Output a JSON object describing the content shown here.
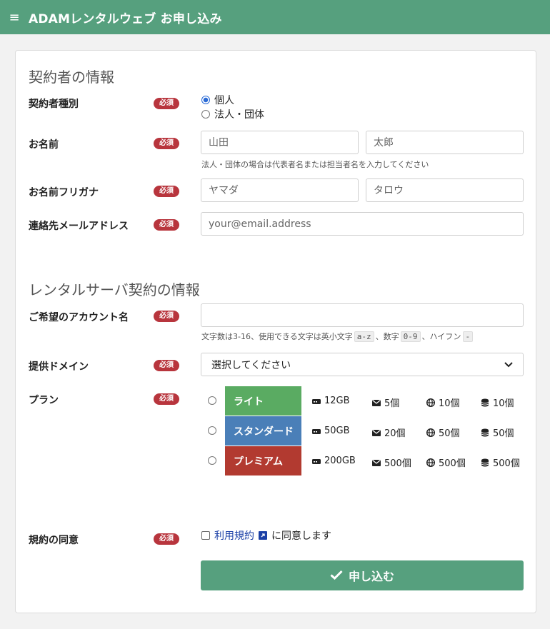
{
  "header": {
    "title": "ADAMレンタルウェブ お申し込み"
  },
  "required_label": "必須",
  "section1": {
    "title": "契約者の情報",
    "type": {
      "label": "契約者種別",
      "options": [
        "個人",
        "法人・団体"
      ],
      "selected": 0
    },
    "name": {
      "label": "お名前",
      "last_placeholder": "山田",
      "first_placeholder": "太郎",
      "help": "法人・団体の場合は代表者名または担当者名を入力してください"
    },
    "kana": {
      "label": "お名前フリガナ",
      "last_placeholder": "ヤマダ",
      "first_placeholder": "タロウ"
    },
    "email": {
      "label": "連絡先メールアドレス",
      "placeholder": "your@email.address"
    }
  },
  "section2": {
    "title": "レンタルサーバ契約の情報",
    "account": {
      "label": "ご希望のアカウント名",
      "help_prefix": "文字数は3-16、使用できる文字は英小文字",
      "code1": "a-z",
      "help_mid1": "、数字",
      "code2": "0-9",
      "help_mid2": "、ハイフン",
      "code3": "-"
    },
    "domain": {
      "label": "提供ドメイン",
      "selected": "選択してください"
    },
    "plan": {
      "label": "プラン",
      "plans": [
        {
          "name": "ライト",
          "color": "#5aab62",
          "disk": "12GB",
          "mail": "5個",
          "web": "10個",
          "db": "10個"
        },
        {
          "name": "スタンダード",
          "color": "#4a7fb8",
          "disk": "50GB",
          "mail": "20個",
          "web": "50個",
          "db": "50個"
        },
        {
          "name": "プレミアム",
          "color": "#b23a30",
          "disk": "200GB",
          "mail": "500個",
          "web": "500個",
          "db": "500個"
        }
      ]
    },
    "terms": {
      "label": "規約の同意",
      "link_text": "利用規約",
      "suffix": "に同意します"
    }
  },
  "submit": {
    "label": "申し込む"
  },
  "colors": {
    "accent": "#56a07e",
    "badge": "#b8353d",
    "link": "#1a3fa6"
  }
}
